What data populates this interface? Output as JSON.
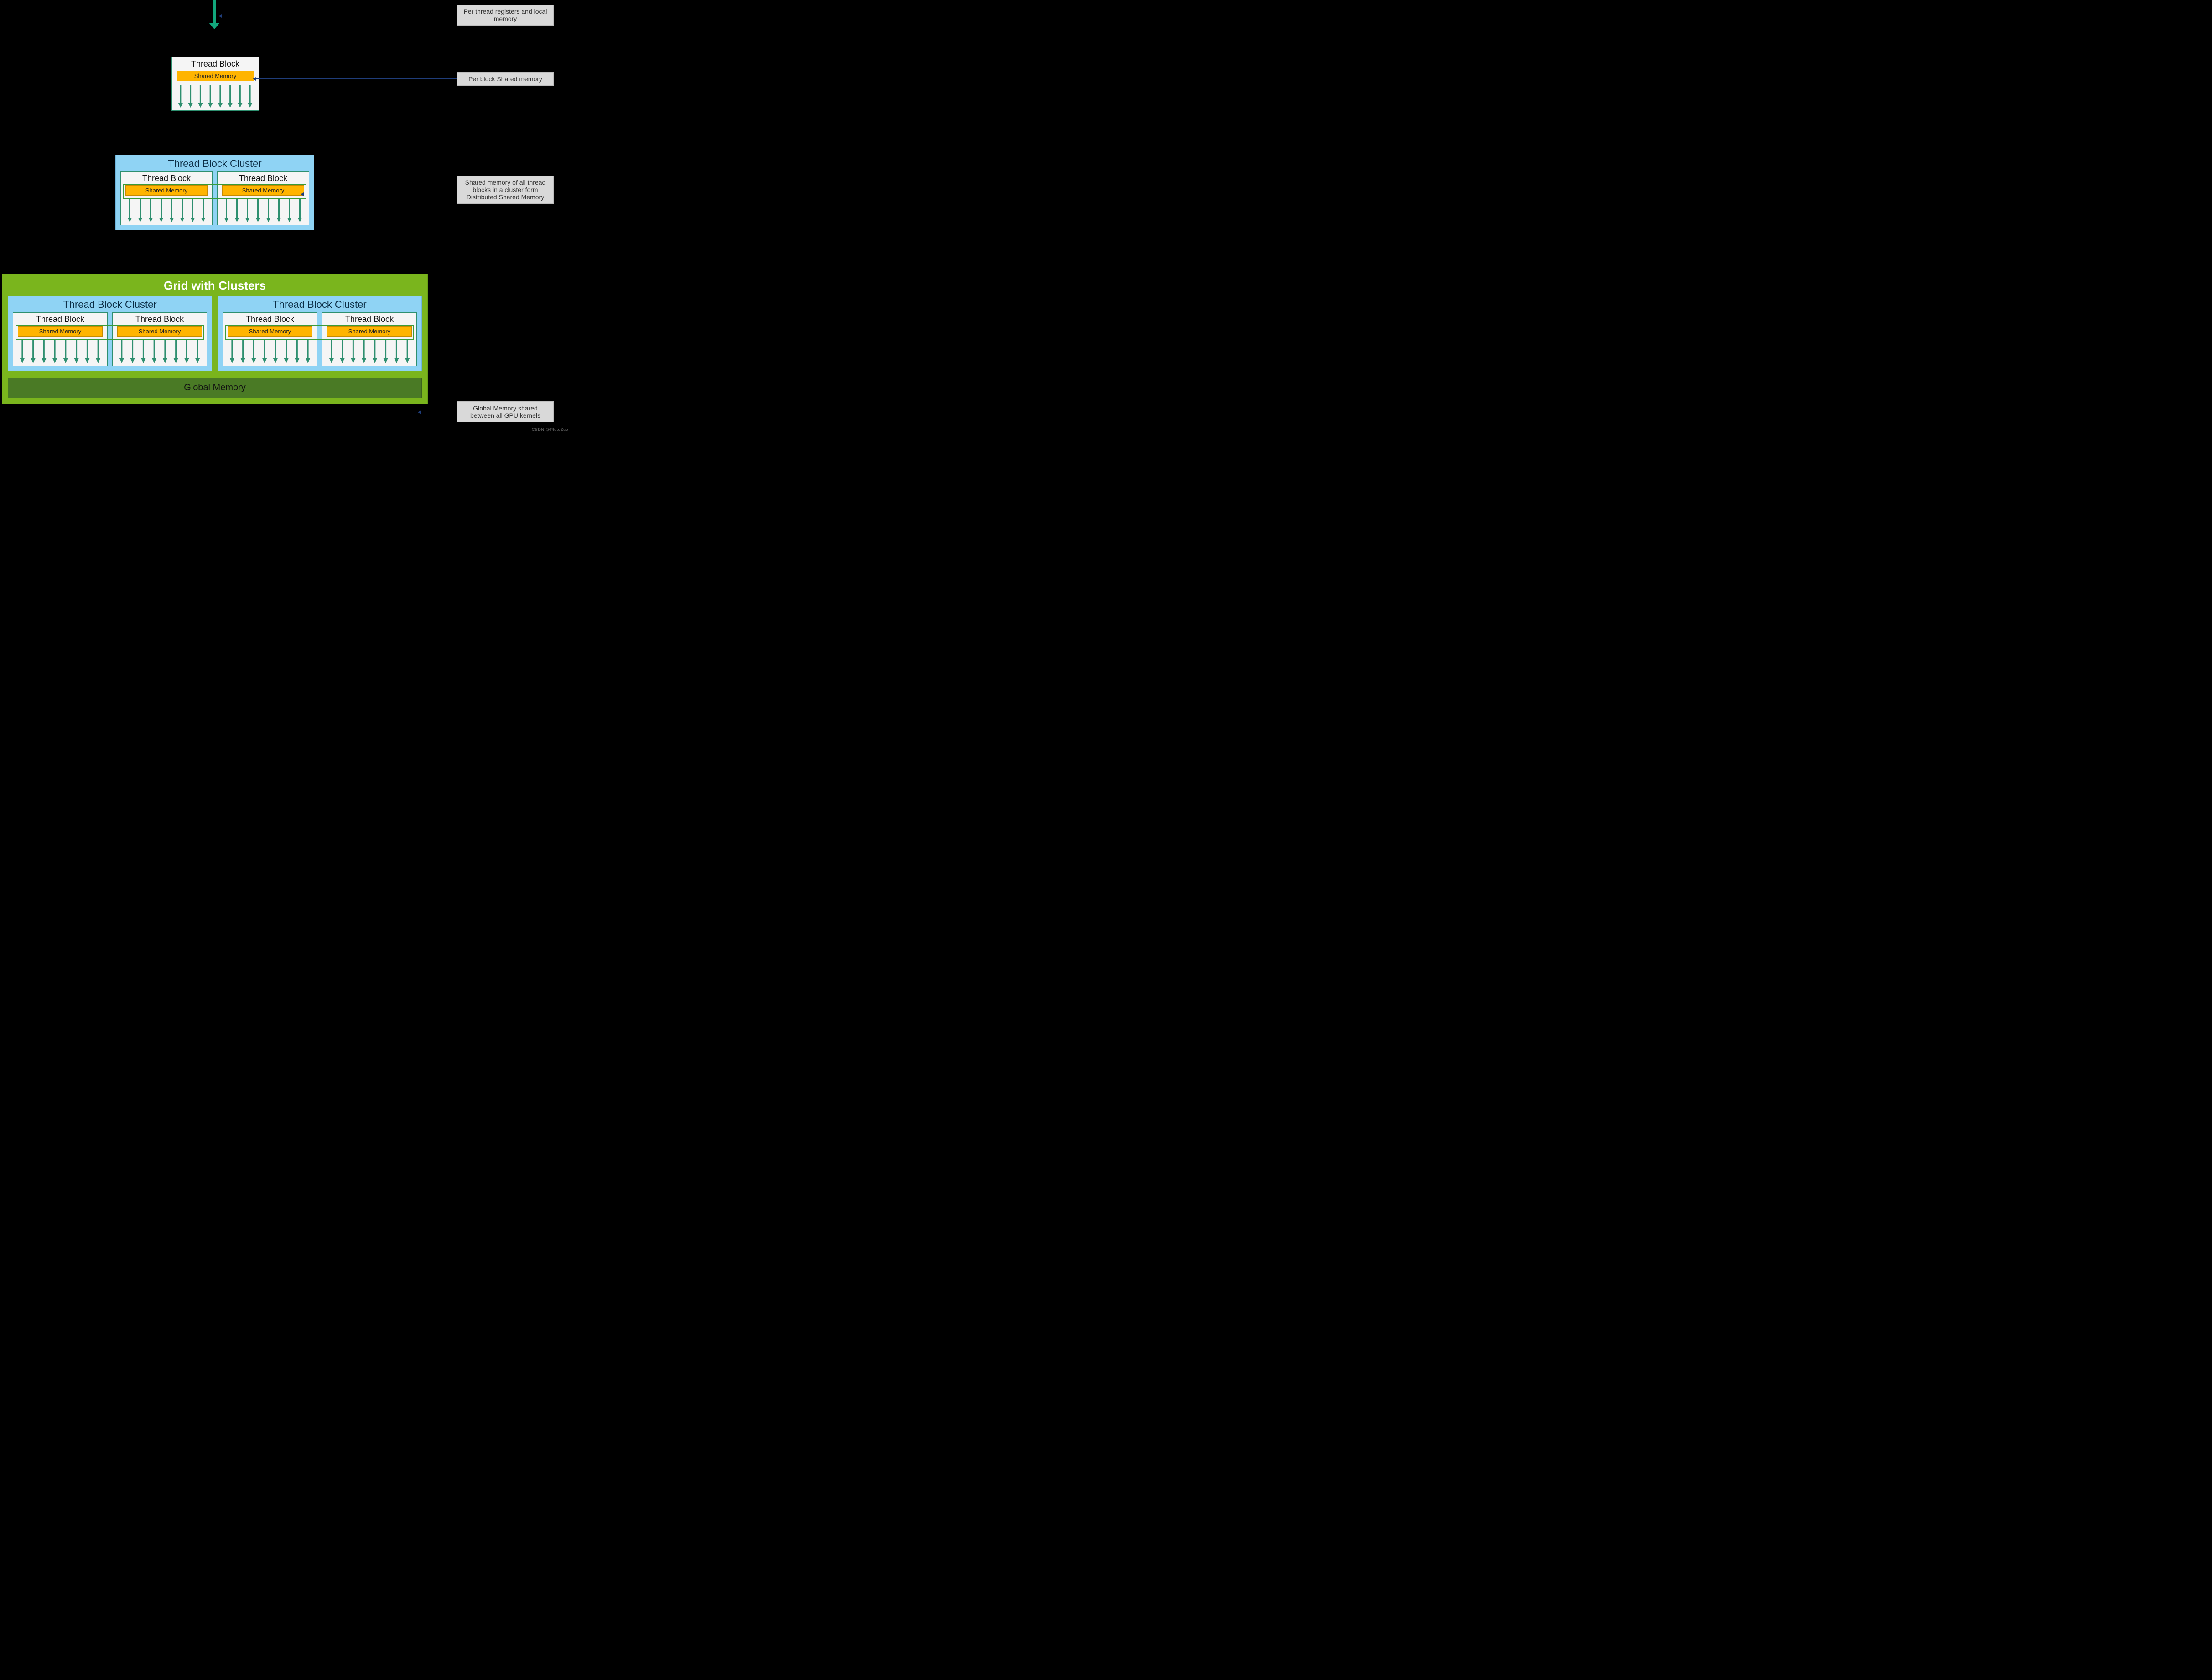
{
  "labels": {
    "thread_block": "Thread Block",
    "shared_memory": "Shared Memory",
    "cluster": "Thread Block Cluster",
    "grid": "Grid with Clusters",
    "global_memory": "Global Memory"
  },
  "callouts": {
    "per_thread": "Per thread registers and local memory",
    "per_block": "Per block Shared memory",
    "dsm": "Shared memory of all thread blocks in a cluster form Distributed Shared Memory",
    "global": "Global Memory shared between all GPU kernels"
  },
  "threads_per_block": 8,
  "blocks_per_cluster": 2,
  "clusters_in_grid": 2,
  "colors": {
    "cluster_bg": "#8fd3f4",
    "grid_bg": "#7ab51d",
    "shared_mem_bg": "#ffb400",
    "global_mem_bg": "#4a7a25",
    "callout_bg": "#d9d9d9",
    "thread_arrow": "#2e8f6f"
  },
  "watermark": "CSDN @PlutoZuo"
}
